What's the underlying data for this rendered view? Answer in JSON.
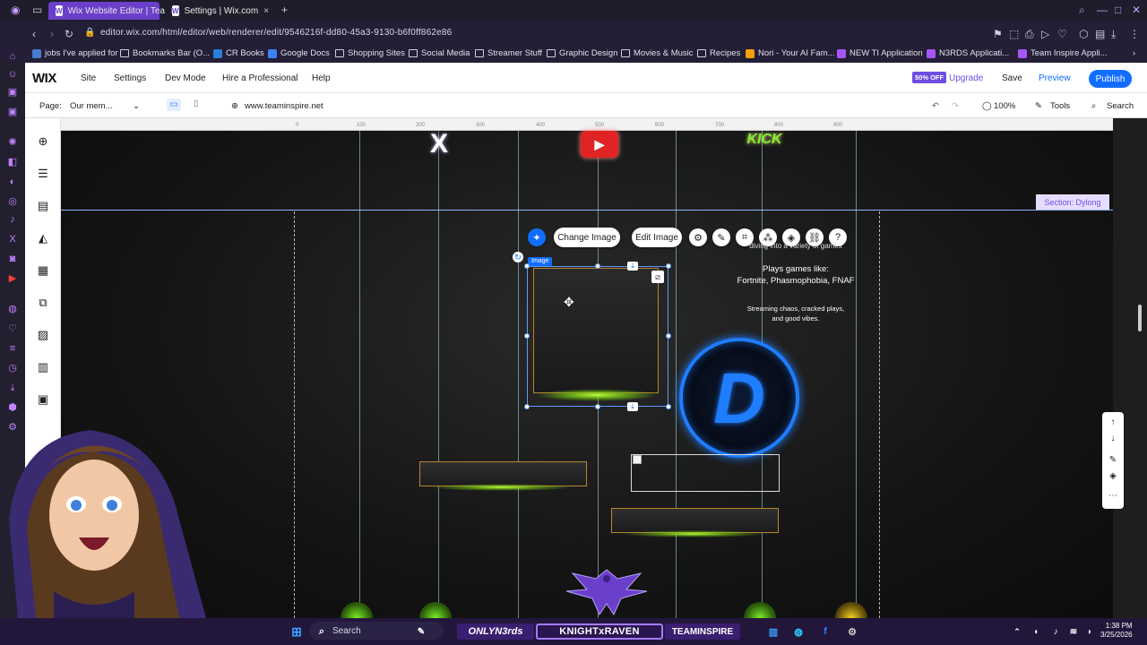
{
  "browser": {
    "tabs": [
      {
        "label": "Wix Website Editor | Tea",
        "active": true
      },
      {
        "label": "Settings | Wix.com",
        "active": false
      }
    ],
    "new_tab": "+",
    "url": "editor.wix.com/html/editor/web/renderer/edit/9546216f-dd80-45a3-9130-b6f0ff862e86",
    "bookmarks": [
      "jobs I've applied for",
      "Bookmarks Bar (O...",
      "CR Books",
      "Google Docs",
      "Shopping Sites",
      "Social Media",
      "Streamer Stuff",
      "Graphic Design",
      "Movies & Music",
      "Recipes",
      "Nori - Your AI Fam...",
      "NEW TI Application",
      "N3RDS Applicati...",
      "Team Inspire Appli..."
    ]
  },
  "wix": {
    "logo": "WIX",
    "menu": [
      "Site",
      "Settings",
      "Dev Mode",
      "Hire a Professional",
      "Help"
    ],
    "badge": "50% OFF",
    "upgrade": "Upgrade",
    "save": "Save",
    "preview": "Preview",
    "publish": "Publish",
    "page_label": "Page:",
    "page_value": "Our mem...",
    "site_url": "www.teaminspire.net",
    "zoom": "100%",
    "tools": "Tools",
    "search": "Search"
  },
  "ruler_ticks": [
    "0",
    "100",
    "200",
    "300",
    "400",
    "500",
    "600",
    "700",
    "800",
    "900"
  ],
  "canvas": {
    "section_label": "Section: Dylong",
    "image_tag": "Image",
    "change_image": "Change Image",
    "edit_image": "Edit Image",
    "text_intro": "diving into a variety of games",
    "text_plays_1": "Plays games like:",
    "text_plays_2": "Fortnite, Phasmophobia, FNAF",
    "text_stream_1": "Streaming chaos, cracked plays,",
    "text_stream_2": "and good vibes.",
    "social_x": "X",
    "social_kick": "KICK",
    "d_logo": "D"
  },
  "taskbar": {
    "search": "Search",
    "onlynerds": "ONLYN3rds",
    "knightraven": "KNIGHTxRAVEN",
    "teaminspire": "TEAMINSPIRE",
    "time": "1:38 PM",
    "date": "3/25/2026"
  },
  "colors": {
    "accent_purple": "#6a3fc9",
    "wix_blue": "#116dff",
    "logo_blue": "#1f7dff",
    "glow_green": "#b8ff3a",
    "gold_border": "#b7862f"
  }
}
